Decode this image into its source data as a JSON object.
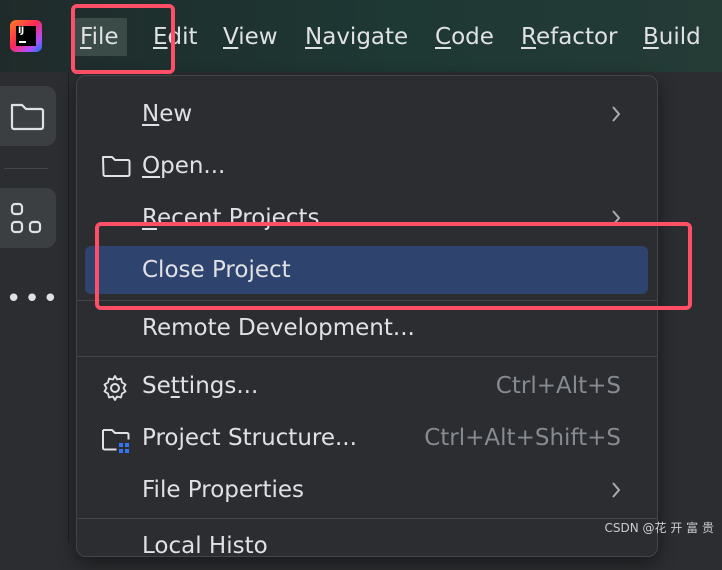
{
  "menubar": {
    "items": [
      {
        "pre": "",
        "mnemo": "F",
        "post": "ile"
      },
      {
        "pre": "",
        "mnemo": "E",
        "post": "dit"
      },
      {
        "pre": "",
        "mnemo": "V",
        "post": "iew"
      },
      {
        "pre": "",
        "mnemo": "N",
        "post": "avigate"
      },
      {
        "pre": "",
        "mnemo": "C",
        "post": "ode"
      },
      {
        "pre": "",
        "mnemo": "R",
        "post": "efactor"
      },
      {
        "pre": "",
        "mnemo": "B",
        "post": "uild"
      }
    ]
  },
  "app_logo": {
    "text": "IJ"
  },
  "file_menu": {
    "items": [
      {
        "pre": "",
        "mnemo": "N",
        "post": "ew",
        "shortcut": "",
        "submenu": true,
        "icon": ""
      },
      {
        "pre": "",
        "mnemo": "O",
        "post": "pen...",
        "shortcut": "",
        "submenu": false,
        "icon": "folder-icon"
      },
      {
        "pre": "",
        "mnemo": "R",
        "post": "ecent Projects",
        "shortcut": "",
        "submenu": true,
        "icon": ""
      },
      {
        "pre": "Close Project",
        "mnemo": "",
        "post": "",
        "shortcut": "",
        "submenu": false,
        "icon": "",
        "selected": true
      },
      {
        "pre": "Remote Development...",
        "mnemo": "",
        "post": "",
        "shortcut": "",
        "submenu": false,
        "icon": ""
      },
      {
        "pre": "Se",
        "mnemo": "t",
        "post": "tings...",
        "shortcut": "Ctrl+Alt+S",
        "submenu": false,
        "icon": "gear-icon"
      },
      {
        "pre": "Project Structure...",
        "mnemo": "",
        "post": "",
        "shortcut": "Ctrl+Alt+Shift+S",
        "submenu": false,
        "icon": "project-structure-icon"
      },
      {
        "pre": "File Properties",
        "mnemo": "",
        "post": "",
        "shortcut": "",
        "submenu": true,
        "icon": ""
      },
      {
        "pre": "Local Histo",
        "mnemo": "",
        "post": "",
        "shortcut": "",
        "submenu": false,
        "icon": ""
      }
    ]
  },
  "colors": {
    "accent_selected": "#2e436e",
    "highlight_annotation": "#ff4f67"
  },
  "watermark": "CSDN @花 开 富 贵"
}
